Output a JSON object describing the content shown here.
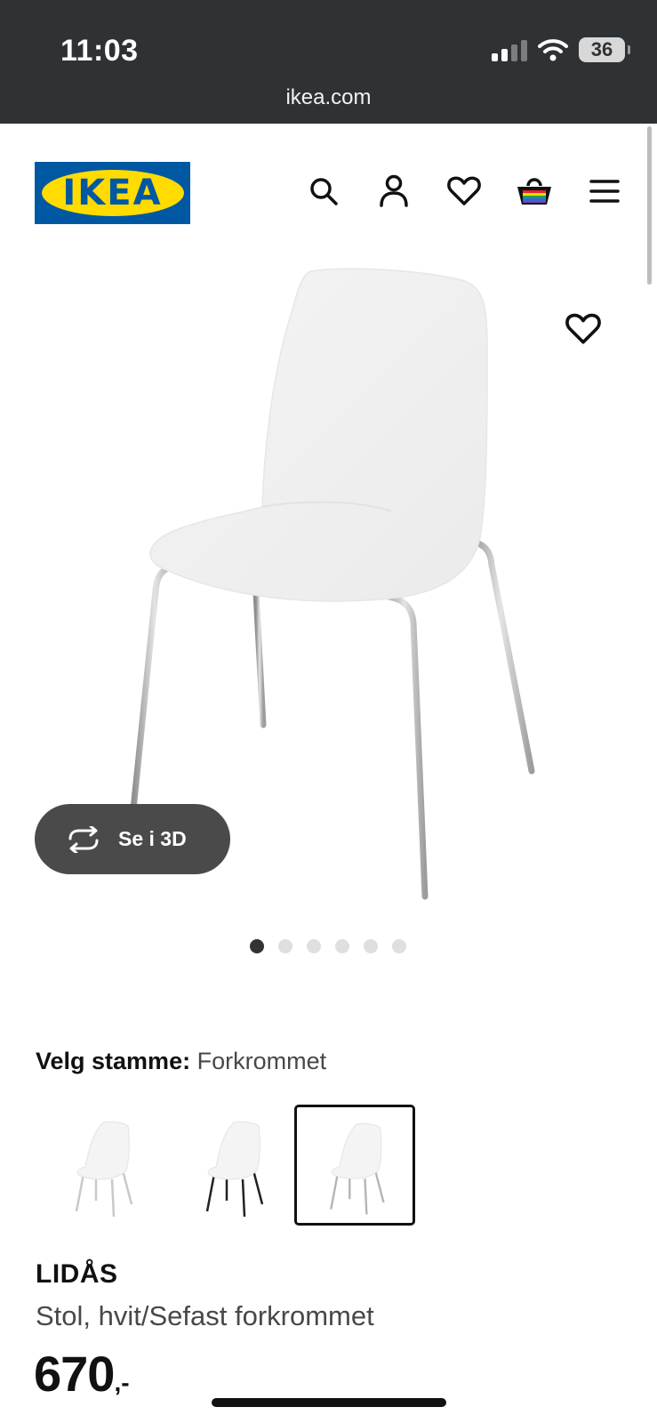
{
  "status_bar": {
    "time": "11:03",
    "battery": "36",
    "icons": [
      "signal-icon",
      "wifi-icon",
      "battery-icon"
    ]
  },
  "browser": {
    "url": "ikea.com"
  },
  "header": {
    "logo_text": "IKEA",
    "icons": [
      "search-icon",
      "account-icon",
      "heart-icon",
      "basket-icon",
      "menu-icon"
    ]
  },
  "gallery": {
    "view_3d_label": "Se i 3D",
    "image_count": 6,
    "active_index": 0
  },
  "variant": {
    "label": "Velg stamme:",
    "value": "Forkrommet",
    "options": [
      {
        "leg_color": "#c9c9c9",
        "selected": false
      },
      {
        "leg_color": "#222222",
        "selected": false
      },
      {
        "leg_color": "#b5b5b5",
        "selected": true
      }
    ]
  },
  "product": {
    "name": "LIDÅS",
    "description": "Stol, hvit/Sefast forkrommet",
    "price": "670",
    "price_suffix": ",-"
  },
  "colors": {
    "ikea_blue": "#0058a3",
    "ikea_yellow": "#ffdb00",
    "topbar": "#2f3234"
  }
}
